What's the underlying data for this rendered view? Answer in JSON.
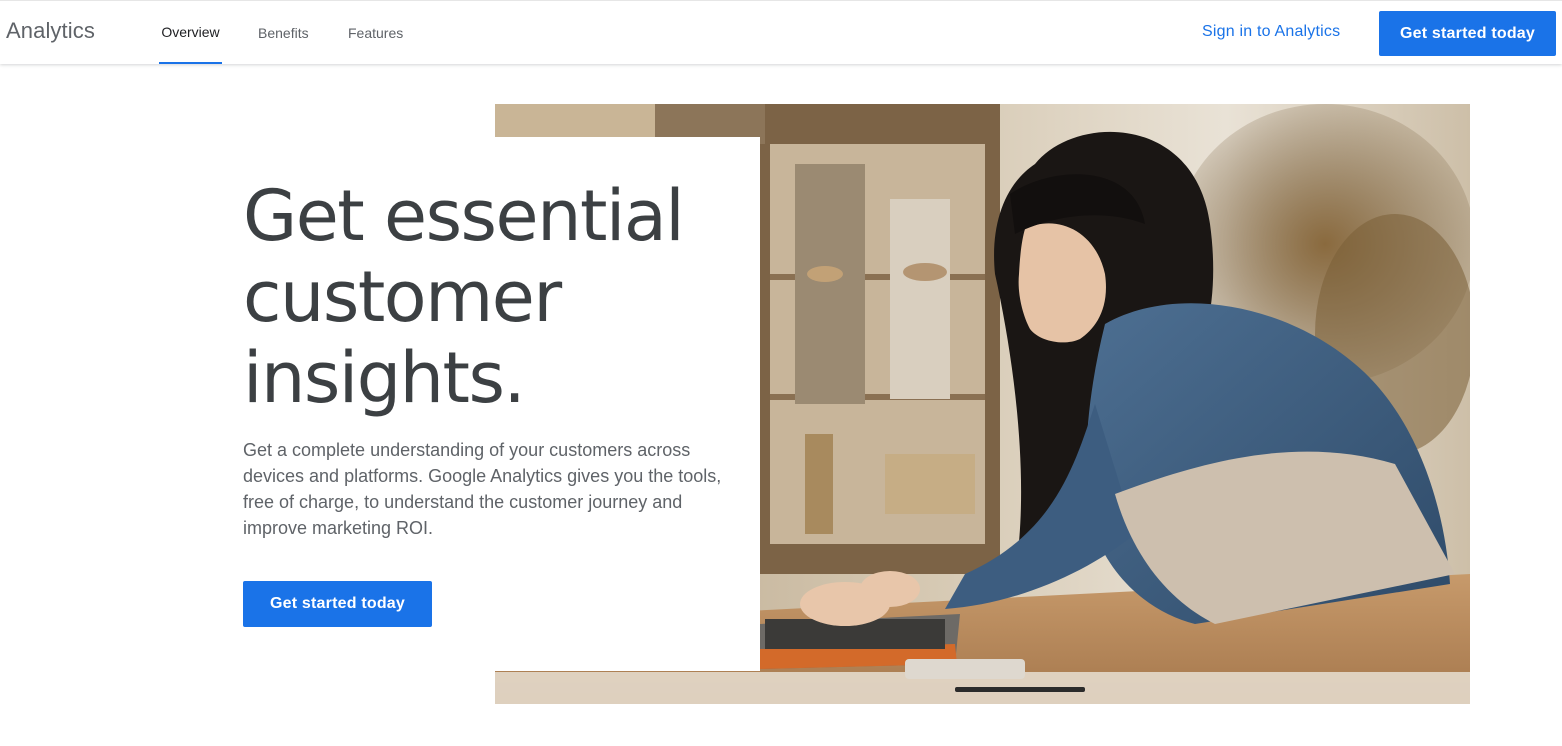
{
  "header": {
    "brand": "Analytics",
    "tabs": [
      {
        "label": "Overview",
        "active": true
      },
      {
        "label": "Benefits",
        "active": false
      },
      {
        "label": "Features",
        "active": false
      }
    ],
    "signin_label": "Sign in to Analytics",
    "cta_label": "Get started today"
  },
  "hero": {
    "headline": "Get essential\ncustomer\ninsights.",
    "body": "Get a complete understanding of your customers across devices and platforms. Google Analytics gives you the tools, free of charge, to understand the customer journey and improve marketing ROI.",
    "cta_label": "Get started today",
    "image_subject": "woman-typing-on-laptop-in-shop"
  },
  "colors": {
    "accent": "#1a73e8",
    "headline": "#3c4043",
    "body_text": "#5f6368"
  }
}
